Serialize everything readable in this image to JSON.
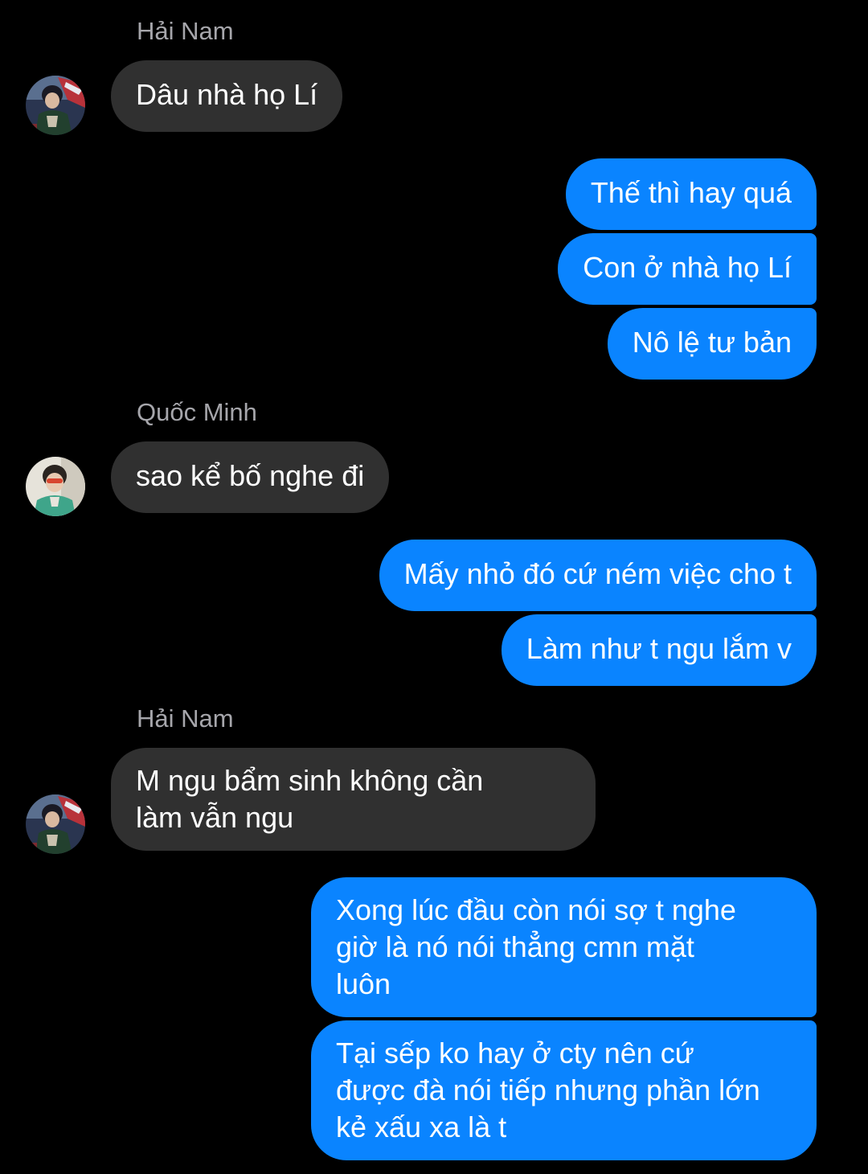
{
  "conversation": {
    "groups": [
      {
        "sender": "Hải Nam",
        "avatar_icon": "user-avatar-hai-nam-icon",
        "messages": [
          "Dâu nhà họ Lí"
        ]
      },
      {
        "sender": "me",
        "messages": [
          "Thế thì hay quá",
          "Con ở nhà họ Lí",
          "Nô lệ tư bản"
        ]
      },
      {
        "sender": "Quốc Minh",
        "avatar_icon": "user-avatar-quoc-minh-icon",
        "messages": [
          "sao kể bố nghe đi"
        ]
      },
      {
        "sender": "me",
        "messages": [
          "Mấy nhỏ đó cứ ném việc cho t",
          "Làm như t ngu lắm v"
        ]
      },
      {
        "sender": "Hải Nam",
        "avatar_icon": "user-avatar-hai-nam-icon",
        "messages": [
          "M ngu bẩm sinh không cần\nlàm vẫn ngu"
        ]
      },
      {
        "sender": "me",
        "messages": [
          "Xong lúc đầu còn nói sợ t nghe\ngiờ là nó nói thẳng cmn mặt\nluôn",
          "Tại sếp ko hay ở cty nên cứ\nđược đà nói tiếp nhưng phần lớn\nkẻ xấu xa là t"
        ]
      }
    ]
  },
  "colors": {
    "background": "#000000",
    "incoming_bubble": "#303030",
    "outgoing_bubble": "#0a84ff",
    "sender_name": "#a6a6ab",
    "text": "#ffffff"
  }
}
